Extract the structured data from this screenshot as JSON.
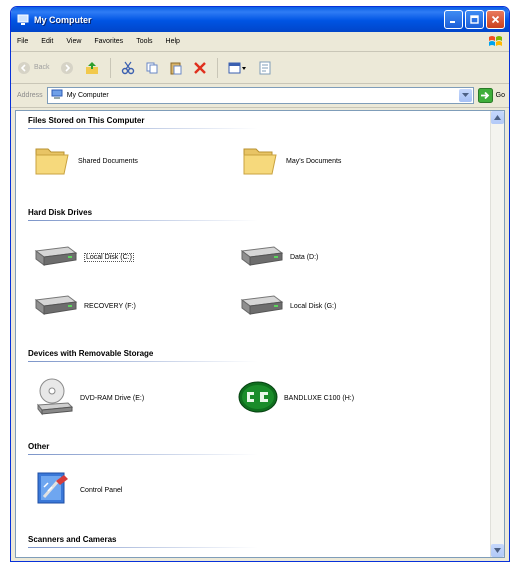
{
  "window": {
    "title": "My Computer"
  },
  "menu": [
    "File",
    "Edit",
    "View",
    "Favorites",
    "Tools",
    "Help"
  ],
  "toolbar": {
    "back_label": "Back"
  },
  "address": {
    "label": "Address",
    "value": "My Computer",
    "go_label": "Go"
  },
  "groups": {
    "files": "Files Stored on This Computer",
    "hdd": "Hard Disk Drives",
    "removable": "Devices with Removable Storage",
    "other": "Other",
    "scanners": "Scanners and Cameras"
  },
  "items": {
    "shared_docs": "Shared Documents",
    "mays_docs": "May's Documents",
    "local_c": "Local Disk (C:)",
    "data_d": "Data (D:)",
    "recovery_f": "RECOVERY (F:)",
    "local_g": "Local Disk (G:)",
    "dvd_e": "DVD-RAM Drive (E:)",
    "bandluxe_h": "BANDLUXE C100 (H:)",
    "control_panel": "Control Panel"
  },
  "colors": {
    "titlebar": "#0054e3",
    "header_line": "#7c95c9",
    "bandluxe": "#1a8c2a"
  }
}
